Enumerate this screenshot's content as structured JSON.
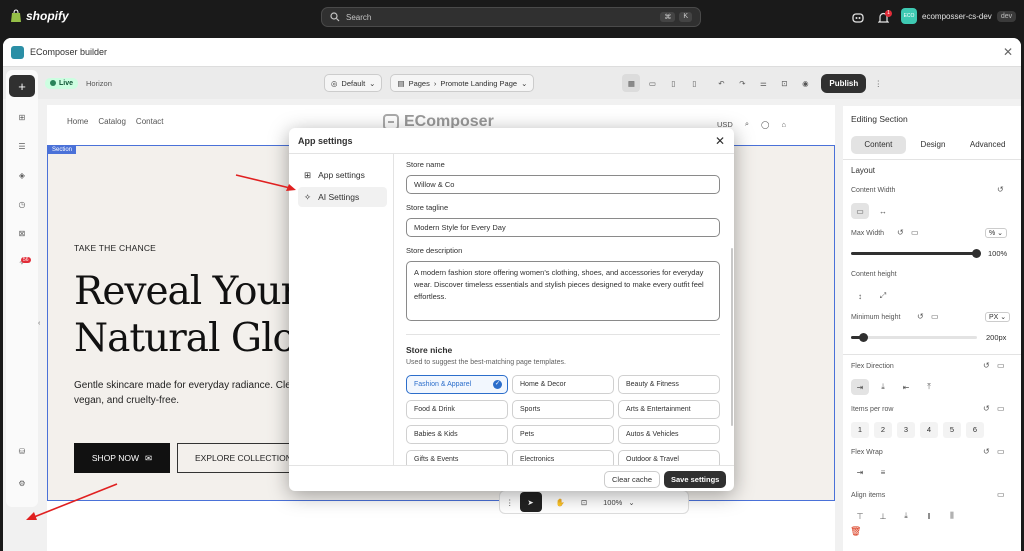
{
  "shopify": {
    "brand": "shopify",
    "search_placeholder": "Search",
    "search_kbd": [
      "⌘",
      "K"
    ],
    "notification_count": "1",
    "store_avatar": "ECO",
    "store_name": "ecomposser-cs-dev",
    "store_tag": "dev"
  },
  "app": {
    "title": "EComposer builder",
    "toolbar": {
      "live_label": "Live",
      "theme_name": "Horizon",
      "device_select": "Default",
      "pages_label": "Pages",
      "page_name": "Promote Landing Page",
      "publish_label": "Publish"
    },
    "rail_badge": "56"
  },
  "canvas": {
    "nav": [
      "Home",
      "Catalog",
      "Contact"
    ],
    "brand": "EComposer",
    "currency": "USD",
    "section_tag": "Section",
    "eyebrow": "TAKE THE CHANCE",
    "headline_line1": "Reveal Your",
    "headline_line2": "Natural Glo",
    "subtext": "Gentle skincare made for everyday radiance. Clean, vegan, and cruelty-free.",
    "shop_now": "SHOP NOW",
    "explore": "EXPLORE COLLECTION",
    "zoom": "100%"
  },
  "right_panel": {
    "title": "Editing Section",
    "tabs": [
      "Content",
      "Design",
      "Advanced"
    ],
    "layout_heading": "Layout",
    "content_width_label": "Content Width",
    "max_width_label": "Max Width",
    "max_width_unit": "%",
    "max_width_value": "100%",
    "max_width_fraction": 1.0,
    "content_height_label": "Content height",
    "min_height_label": "Minimum height",
    "min_height_unit": "PX",
    "min_height_value": "200px",
    "min_height_fraction": 0.1,
    "flex_direction_label": "Flex Direction",
    "items_per_row_label": "Items per row",
    "items_per_row_options": [
      "1",
      "2",
      "3",
      "4",
      "5",
      "6"
    ],
    "flex_wrap_label": "Flex Wrap",
    "align_items_label": "Align items"
  },
  "modal": {
    "title": "App settings",
    "sidebar": [
      {
        "label": "App settings",
        "icon": "grid-icon"
      },
      {
        "label": "AI Settings",
        "icon": "sparkle-icon"
      }
    ],
    "store_name_label": "Store name",
    "store_name_value": "Willow & Co",
    "store_tagline_label": "Store tagline",
    "store_tagline_value": "Modern Style for Every Day",
    "store_description_label": "Store description",
    "store_description_value": "A modern fashion store offering women's clothing, shoes, and accessories for everyday wear. Discover timeless essentials and stylish pieces designed to make every outfit feel effortless.",
    "niche_title": "Store niche",
    "niche_subtitle": "Used to suggest the best-matching page templates.",
    "niches": [
      {
        "label": "Fashion & Apparel",
        "selected": true
      },
      {
        "label": "Home & Decor",
        "selected": false
      },
      {
        "label": "Beauty & Fitness",
        "selected": false
      },
      {
        "label": "Food & Drink",
        "selected": false
      },
      {
        "label": "Sports",
        "selected": false
      },
      {
        "label": "Arts & Entertainment",
        "selected": false
      },
      {
        "label": "Babies & Kids",
        "selected": false
      },
      {
        "label": "Pets",
        "selected": false
      },
      {
        "label": "Autos & Vehicles",
        "selected": false
      },
      {
        "label": "Gifts & Events",
        "selected": false
      },
      {
        "label": "Electronics",
        "selected": false
      },
      {
        "label": "Outdoor & Travel",
        "selected": false
      }
    ],
    "clear_cache": "Clear cache",
    "save_settings": "Save settings"
  },
  "colors": {
    "accent": "#2c6ecb",
    "annotation_arrow": "#e02020",
    "section_outline": "#4a71d8"
  }
}
